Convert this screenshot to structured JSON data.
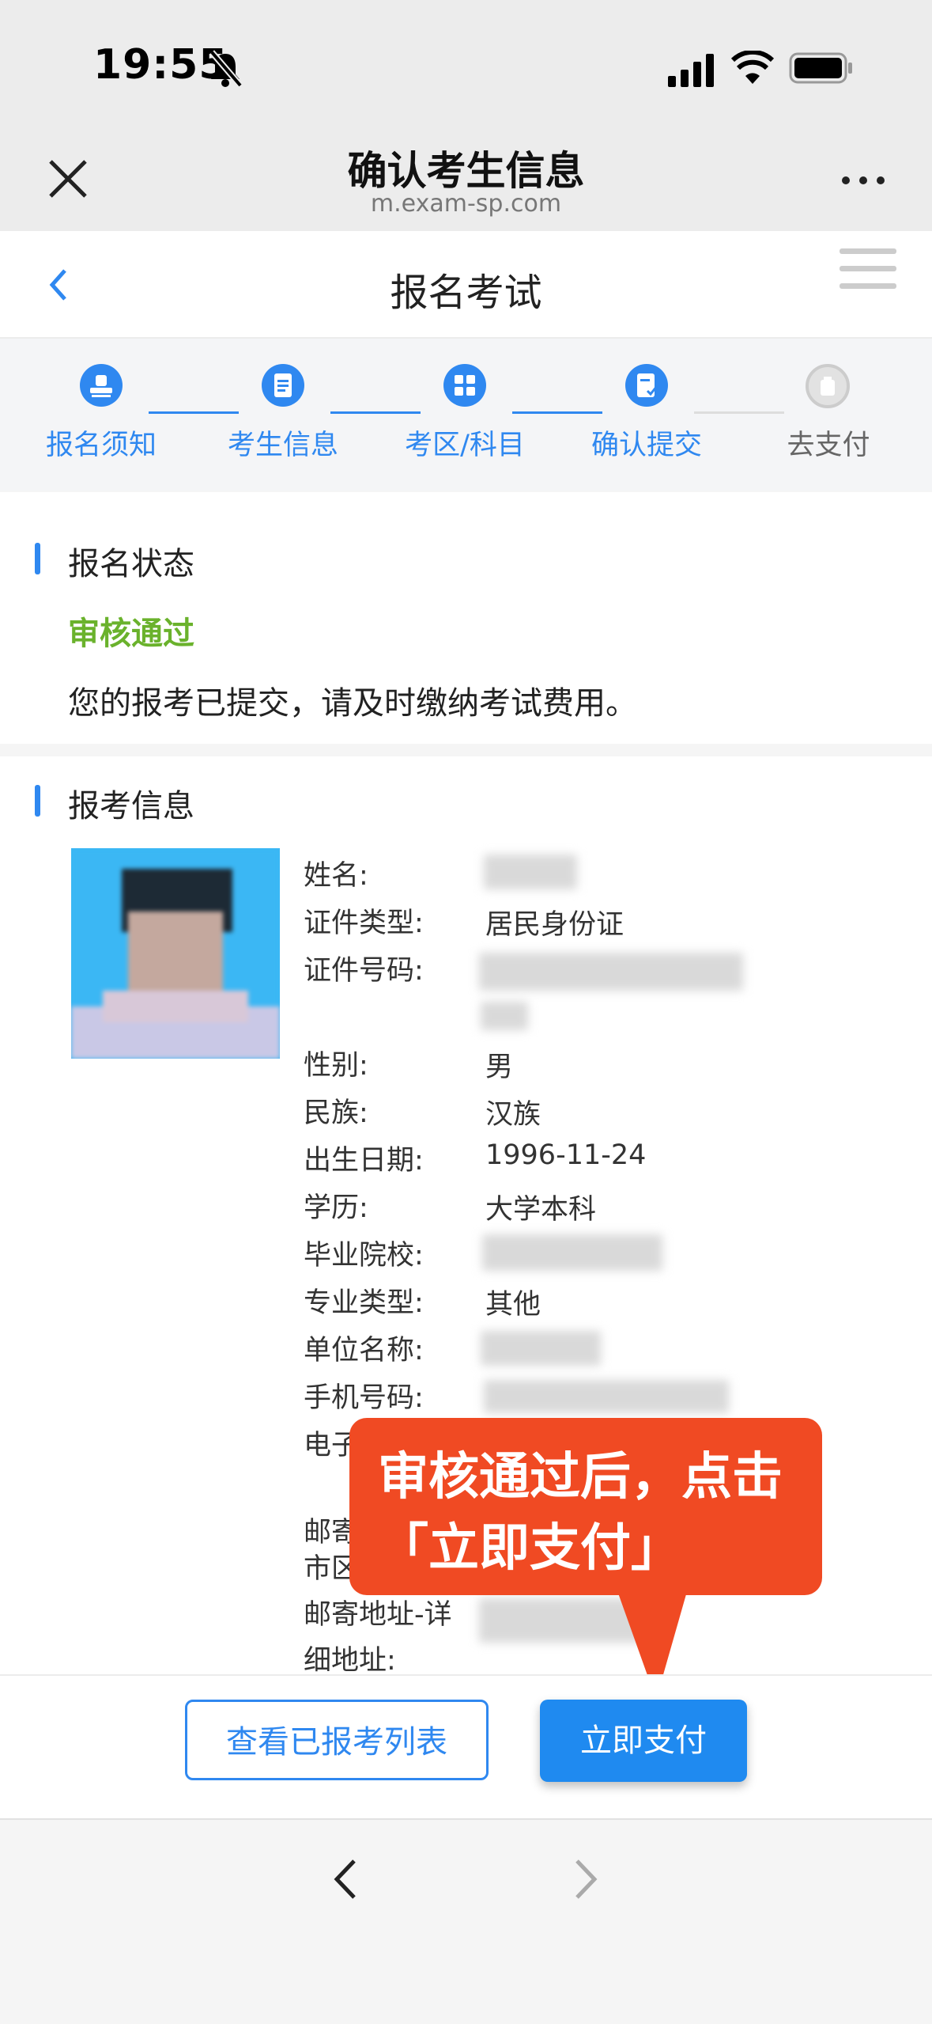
{
  "status_bar": {
    "time": "19:55"
  },
  "browser": {
    "title": "确认考生信息",
    "url": "m.exam-sp.com"
  },
  "app": {
    "title": "报名考试"
  },
  "steps": [
    {
      "label": "报名须知",
      "done": true
    },
    {
      "label": "考生信息",
      "done": true
    },
    {
      "label": "考区/科目",
      "done": true
    },
    {
      "label": "确认提交",
      "done": true
    },
    {
      "label": "去支付",
      "done": false
    }
  ],
  "status_section": {
    "title": "报名状态",
    "value": "审核通过",
    "message": "您的报考已提交，请及时缴纳考试费用。"
  },
  "info_section": {
    "title": "报考信息",
    "fields": {
      "name": {
        "label": "姓名:",
        "value": ""
      },
      "id_type": {
        "label": "证件类型:",
        "value": "居民身份证"
      },
      "id_number": {
        "label": "证件号码:",
        "value": ""
      },
      "gender": {
        "label": "性别:",
        "value": "男"
      },
      "ethnicity": {
        "label": "民族:",
        "value": "汉族"
      },
      "birthdate": {
        "label": "出生日期:",
        "value": "1996-11-24"
      },
      "education": {
        "label": "学历:",
        "value": "大学本科"
      },
      "school": {
        "label": "毕业院校:",
        "value": ""
      },
      "major_type": {
        "label": "专业类型:",
        "value": "其他"
      },
      "employer": {
        "label": "单位名称:",
        "value": ""
      },
      "phone": {
        "label": "手机号码:",
        "value": ""
      },
      "email": {
        "label": "电子",
        "value": ""
      },
      "mail_region": {
        "label": "邮寄\n市区",
        "value": ""
      },
      "mail_address": {
        "label": "邮寄地址-详\n细地址:",
        "value": ""
      }
    }
  },
  "callout": {
    "text": "审核通过后，点击「立即支付」"
  },
  "actions": {
    "view_list": "查看已报考列表",
    "pay": "立即支付"
  },
  "colors": {
    "accent": "#2f88f0",
    "success": "#6ab22c",
    "callout": "#f04a23"
  }
}
